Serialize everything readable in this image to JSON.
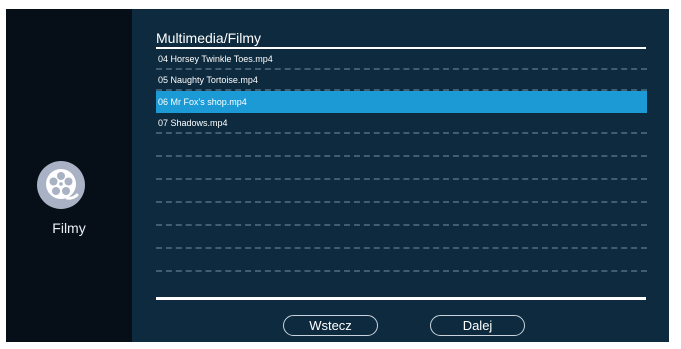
{
  "sidebar": {
    "app_icon": "film-reel-icon",
    "app_label": "Filmy"
  },
  "main": {
    "breadcrumb": "Multimedia/Filmy",
    "files": [
      "04 Horsey Twinkle Toes.mp4",
      "05 Naughty Tortoise.mp4",
      "06 Mr Fox's shop.mp4",
      "07 Shadows.mp4"
    ],
    "selected_index": 2
  },
  "footer": {
    "back_label": "Wstecz",
    "next_label": "Dalej",
    "refresh_icon": "refresh-icon"
  },
  "colors": {
    "panel": "#0d2a3e",
    "sidebar": "#060f18",
    "selection": "#1b9ad6",
    "refresh": "#1797d8"
  }
}
